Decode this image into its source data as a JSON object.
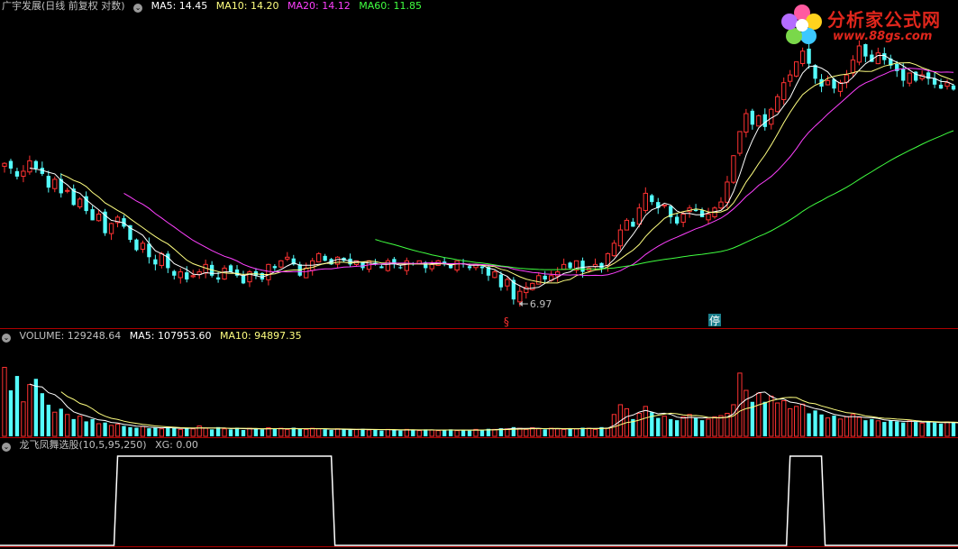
{
  "header_main": {
    "title": "广宇发展(日线 前复权 对数)",
    "ma5": "MA5: 14.45",
    "ma10": "MA10: 14.20",
    "ma20": "MA20: 14.12",
    "ma60": "MA60: 11.85"
  },
  "header_volume": {
    "title": "VOLUME: 129248.64",
    "ma5": "MA5: 107953.60",
    "ma10": "MA10: 94897.35"
  },
  "header_indicator": {
    "title": "龙飞凤舞选股(10,5,95,250)",
    "xg": "XG: 0.00"
  },
  "logo": {
    "title": "分析家公式网",
    "url": "www.88gs.com"
  },
  "markers": {
    "low_label": "6.97",
    "dividend_marker": "§",
    "suspend_marker": "停"
  },
  "colors": {
    "background": "#000000",
    "up": "#ff3232",
    "down": "#54fcfc",
    "ma5": "#ffffff",
    "ma10": "#ffff80",
    "ma20": "#ff40ff",
    "ma60": "#40ff40",
    "divider": "#b00000"
  },
  "chart_data": [
    {
      "type": "candlestick",
      "title": "广宇发展(日线 前复权 对数)",
      "y_scale": "log",
      "low_annotation": 6.97,
      "closes": [
        11.2,
        11.0,
        10.7,
        10.9,
        11.3,
        11.0,
        10.8,
        10.3,
        10.6,
        10.1,
        10.2,
        9.7,
        9.9,
        9.5,
        9.2,
        9.4,
        8.8,
        9.1,
        9.3,
        9.0,
        8.6,
        8.3,
        8.5,
        8.1,
        7.9,
        8.2,
        7.8,
        7.6,
        7.7,
        7.5,
        7.6,
        7.7,
        7.9,
        7.6,
        7.5,
        7.8,
        7.7,
        7.6,
        7.4,
        7.7,
        7.6,
        7.5,
        7.9,
        7.8,
        8.0,
        8.1,
        7.9,
        7.6,
        7.8,
        8.0,
        8.2,
        8.0,
        7.9,
        8.1,
        8.0,
        7.9,
        8.0,
        7.8,
        8.0,
        7.9,
        7.8,
        8.0,
        7.9,
        7.8,
        8.0,
        7.9,
        8.0,
        7.8,
        7.9,
        8.0,
        7.9,
        7.8,
        8.0,
        7.9,
        7.8,
        7.9,
        7.8,
        7.6,
        7.7,
        7.3,
        7.5,
        7.0,
        7.2,
        7.3,
        7.4,
        7.6,
        7.5,
        7.6,
        7.7,
        7.9,
        7.8,
        8.0,
        7.7,
        7.8,
        7.9,
        7.8,
        8.2,
        8.5,
        8.9,
        9.2,
        9.0,
        9.6,
        10.1,
        9.8,
        9.6,
        9.7,
        9.3,
        9.1,
        9.4,
        9.6,
        9.5,
        9.3,
        9.4,
        9.6,
        9.8,
        10.5,
        11.5,
        12.5,
        13.3,
        12.8,
        13.2,
        12.7,
        13.5,
        14.1,
        14.8,
        15.2,
        15.9,
        16.5,
        15.8,
        15.0,
        14.6,
        14.9,
        14.5,
        14.8,
        15.2,
        16.0,
        16.8,
        16.2,
        15.9,
        16.4,
        16.0,
        15.7,
        15.4,
        14.9,
        15.3,
        14.9,
        15.2,
        15.0,
        14.7,
        14.5,
        14.8,
        14.45
      ],
      "ma_lines": [
        "MA5: 14.45",
        "MA10: 14.20",
        "MA20: 14.12",
        "MA60: 11.85"
      ]
    },
    {
      "type": "bar",
      "title": "VOLUME: 129248.64",
      "volume_scale_max": 160000,
      "values": [
        120000,
        80000,
        105000,
        60000,
        90000,
        100000,
        75000,
        55000,
        42000,
        48000,
        38000,
        30000,
        35000,
        26000,
        30000,
        22000,
        24000,
        19000,
        21000,
        18000,
        16000,
        15000,
        17000,
        14000,
        15000,
        13000,
        16000,
        14000,
        12000,
        15000,
        13000,
        18000,
        14000,
        12000,
        16000,
        13000,
        12000,
        15000,
        11000,
        14000,
        13000,
        12000,
        15000,
        13000,
        14000,
        12000,
        15000,
        13000,
        12000,
        14000,
        13000,
        12000,
        11000,
        13000,
        12000,
        11000,
        12000,
        13000,
        11000,
        12000,
        10000,
        12000,
        11000,
        10000,
        12000,
        11000,
        10000,
        12000,
        11000,
        10000,
        11000,
        12000,
        10000,
        11000,
        10000,
        12000,
        11000,
        13000,
        12000,
        14000,
        13000,
        16000,
        14000,
        12000,
        15000,
        13000,
        12000,
        14000,
        13000,
        12000,
        14000,
        13000,
        15000,
        14000,
        12000,
        16000,
        14000,
        38000,
        55000,
        48000,
        30000,
        40000,
        52000,
        42000,
        32000,
        35000,
        30000,
        28000,
        34000,
        38000,
        32000,
        28000,
        30000,
        34000,
        36000,
        40000,
        55000,
        110000,
        80000,
        60000,
        75000,
        60000,
        70000,
        58000,
        62000,
        48000,
        52000,
        56000,
        40000,
        45000,
        38000,
        32000,
        36000,
        30000,
        34000,
        38000,
        33000,
        28000,
        30000,
        27000,
        25000,
        28000,
        26000,
        24000,
        27000,
        25000,
        23000,
        26000,
        24000,
        22000,
        25000,
        24000,
        21000,
        23000,
        22000,
        24000,
        21000,
        22000,
        30000
      ],
      "ma_lines": [
        "MA5: 107953.60",
        "MA10: 94897.35"
      ]
    },
    {
      "type": "line",
      "title": "龙飞凤舞选股(10,5,95,250)",
      "series": [
        {
          "name": "XG",
          "segments": [
            [
              18,
              52,
              1
            ],
            [
              125,
              130,
              1
            ]
          ]
        }
      ],
      "ylim": [
        0,
        1
      ],
      "current": "XG: 0.00"
    }
  ]
}
